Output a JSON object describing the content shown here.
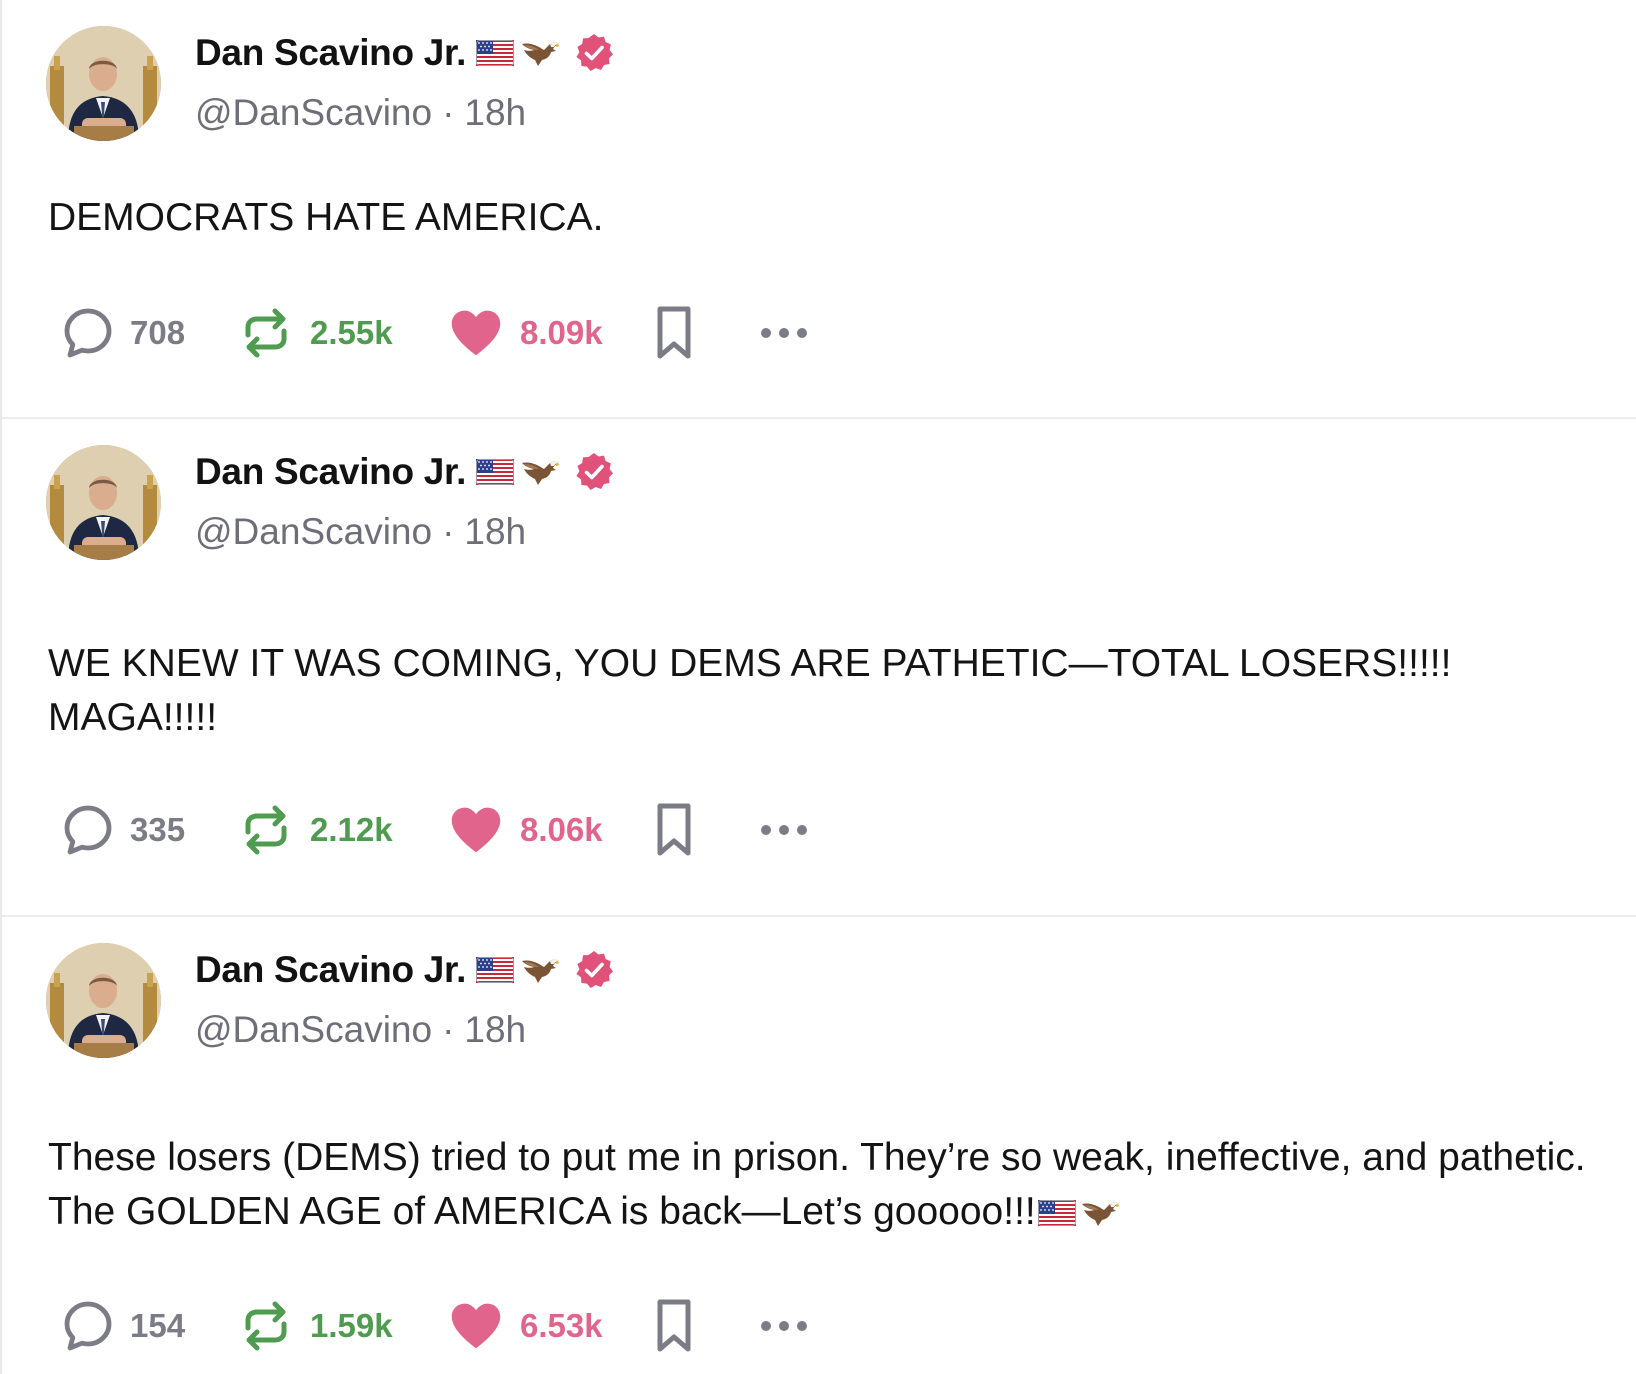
{
  "posts": [
    {
      "author_name": "Dan Scavino Jr.",
      "author_suffix_icons": [
        "us-flag-icon",
        "eagle-icon"
      ],
      "handle": "@DanScavino",
      "separator": "·",
      "time": "18h",
      "text": "DEMOCRATS HATE AMERICA.",
      "replies": "708",
      "reposts": "2.55k",
      "likes": "8.09k"
    },
    {
      "author_name": "Dan Scavino Jr.",
      "author_suffix_icons": [
        "us-flag-icon",
        "eagle-icon"
      ],
      "handle": "@DanScavino",
      "separator": "·",
      "time": "18h",
      "text": "WE KNEW IT WAS COMING, YOU DEMS ARE PATHETIC—TOTAL LOSERS!!!!! MAGA!!!!!",
      "replies": "335",
      "reposts": "2.12k",
      "likes": "8.06k"
    },
    {
      "author_name": "Dan Scavino Jr.",
      "author_suffix_icons": [
        "us-flag-icon",
        "eagle-icon"
      ],
      "handle": "@DanScavino",
      "separator": "·",
      "time": "18h",
      "text": "These losers (DEMS) tried to put me in prison. They’re so weak, ineffective, and pathetic. The GOLDEN AGE of AMERICA is back—Let’s gooooo!!!",
      "text_suffix_icons": [
        "us-flag-icon",
        "eagle-icon"
      ],
      "replies": "154",
      "reposts": "1.59k",
      "likes": "6.53k"
    }
  ],
  "colors": {
    "verified": "#e0527a",
    "repost": "#4f9b4f",
    "like": "#e0648b",
    "muted": "#6e6e78",
    "divider": "#ececef"
  }
}
